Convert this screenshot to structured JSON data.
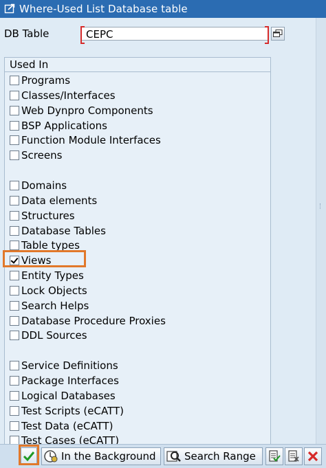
{
  "window": {
    "title": "Where-Used List Database table"
  },
  "db_table": {
    "label": "DB Table",
    "value": "CEPC"
  },
  "group": {
    "title": "Used In",
    "items": [
      {
        "label": "Programs",
        "checked": false
      },
      {
        "label": "Classes/Interfaces",
        "checked": false
      },
      {
        "label": "Web Dynpro Components",
        "checked": false
      },
      {
        "label": "BSP Applications",
        "checked": false
      },
      {
        "label": "Function Module Interfaces",
        "checked": false
      },
      {
        "label": "Screens",
        "checked": false
      },
      {
        "label": "Domains",
        "checked": false
      },
      {
        "label": "Data elements",
        "checked": false
      },
      {
        "label": "Structures",
        "checked": false
      },
      {
        "label": "Database Tables",
        "checked": false
      },
      {
        "label": "Table types",
        "checked": false
      },
      {
        "label": "Views",
        "checked": true
      },
      {
        "label": "Entity Types",
        "checked": false
      },
      {
        "label": "Lock Objects",
        "checked": false
      },
      {
        "label": "Search Helps",
        "checked": false
      },
      {
        "label": "Database Procedure Proxies",
        "checked": false
      },
      {
        "label": "DDL Sources",
        "checked": false
      },
      {
        "label": "Service Definitions",
        "checked": false
      },
      {
        "label": "Package Interfaces",
        "checked": false
      },
      {
        "label": "Logical Databases",
        "checked": false
      },
      {
        "label": "Test Scripts (eCATT)",
        "checked": false
      },
      {
        "label": "Test Data (eCATT)",
        "checked": false
      },
      {
        "label": "Test Cases (eCATT)",
        "checked": false
      }
    ]
  },
  "toolbar": {
    "background_label": "In the Background",
    "search_range_label": "Search Range"
  },
  "colors": {
    "title_bar": "#2b6cb2",
    "highlight": "#e1782a",
    "required": "#d62a2a"
  }
}
